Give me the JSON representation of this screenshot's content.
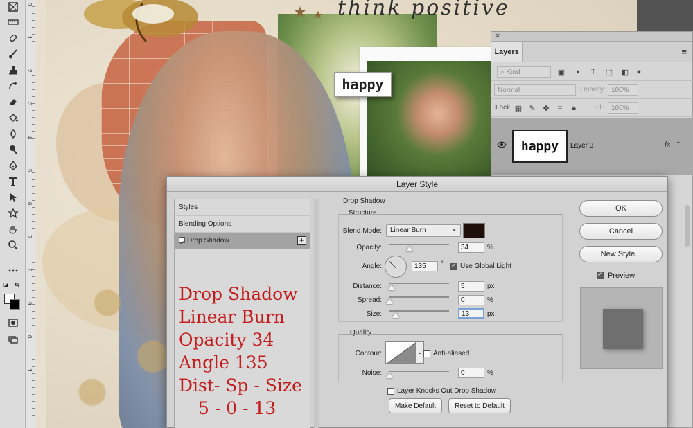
{
  "canvas": {
    "title_text": "think positive",
    "tag_text": "happy"
  },
  "ruler": {
    "ticks": [
      "0",
      "1",
      "2",
      "3",
      "4",
      "5",
      "6",
      "7",
      "8",
      "9",
      "0",
      "1"
    ]
  },
  "layers_panel": {
    "close_glyph": "×",
    "tab_label": "Layers",
    "menu_glyph": "≡",
    "filter_placeholder": "Kind",
    "blend_mode": "Normal",
    "opacity_label": "Opacity:",
    "opacity_value": "100%",
    "lock_label": "Lock:",
    "fill_label": "Fill:",
    "fill_value": "100%",
    "layer": {
      "thumb_text": "happy",
      "name": "Layer 3",
      "fx": "fx"
    }
  },
  "dialog": {
    "title": "Layer Style",
    "styles_list": [
      {
        "label": "Styles"
      },
      {
        "label": "Blending Options"
      },
      {
        "label": "Drop Shadow"
      }
    ],
    "annotation_lines": [
      "Drop Shadow",
      "Linear Burn",
      "Opacity 34",
      "Angle 135",
      "Dist- Sp - Size",
      "5 - 0 - 13"
    ],
    "section_title": "Drop Shadow",
    "structure_title": "Structure",
    "blend_mode_label": "Blend Mode:",
    "blend_mode_value": "Linear Burn",
    "shadow_color": "#1e0f0b",
    "opacity_label": "Opacity:",
    "opacity_value": "34",
    "opacity_unit": "%",
    "angle_label": "Angle:",
    "angle_value": "135",
    "angle_unit": "°",
    "use_global_light": "Use Global Light",
    "distance_label": "Distance:",
    "distance_value": "5",
    "distance_unit": "px",
    "spread_label": "Spread:",
    "spread_value": "0",
    "spread_unit": "%",
    "size_label": "Size:",
    "size_value": "13",
    "size_unit": "px",
    "quality_title": "Quality",
    "contour_label": "Contour:",
    "anti_aliased": "Anti-aliased",
    "noise_label": "Noise:",
    "noise_value": "0",
    "noise_unit": "%",
    "knockout_label": "Layer Knocks Out Drop Shadow",
    "make_default": "Make Default",
    "reset_default": "Reset to Default",
    "ok": "OK",
    "cancel": "Cancel",
    "new_style": "New Style...",
    "preview": "Preview"
  }
}
